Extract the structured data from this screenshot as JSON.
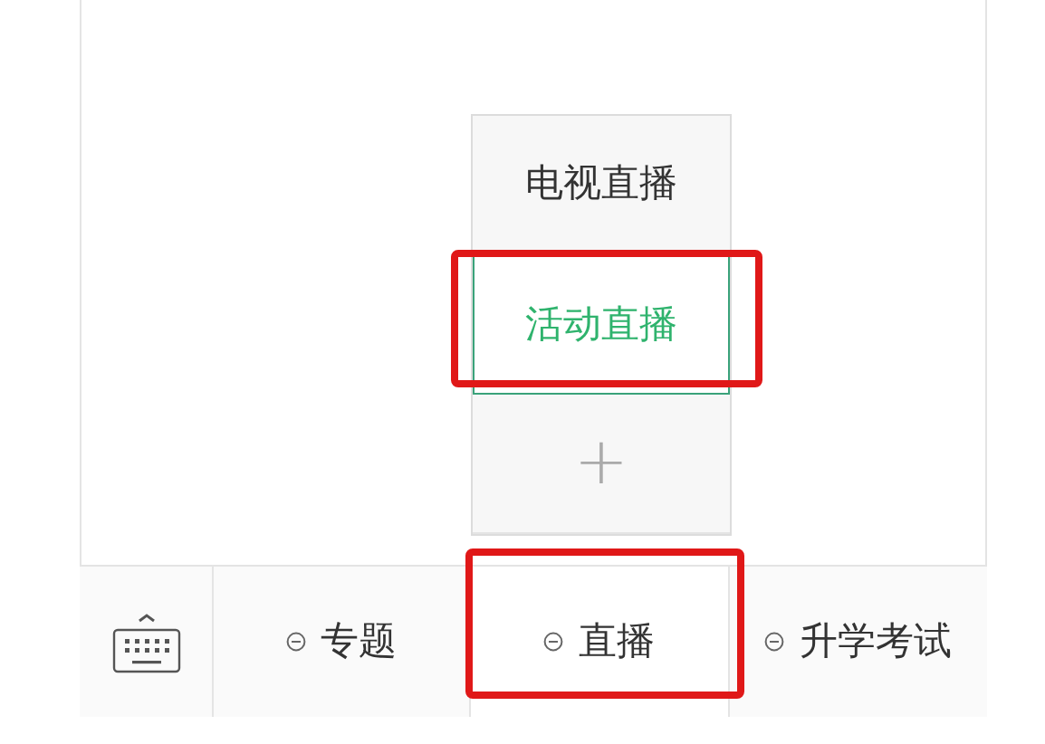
{
  "submenu": {
    "items": [
      {
        "kind": "item",
        "label": "电视直播",
        "selected": false,
        "highlighted": false
      },
      {
        "kind": "item",
        "label": "活动直播",
        "selected": true,
        "highlighted": true
      },
      {
        "kind": "add",
        "label": "+",
        "selected": false,
        "highlighted": false
      }
    ]
  },
  "menu_bar": {
    "items": [
      {
        "label": "专题",
        "selected": false,
        "highlighted": false
      },
      {
        "label": "直播",
        "selected": true,
        "highlighted": true
      },
      {
        "label": "升学考试",
        "selected": false,
        "highlighted": false
      }
    ]
  }
}
